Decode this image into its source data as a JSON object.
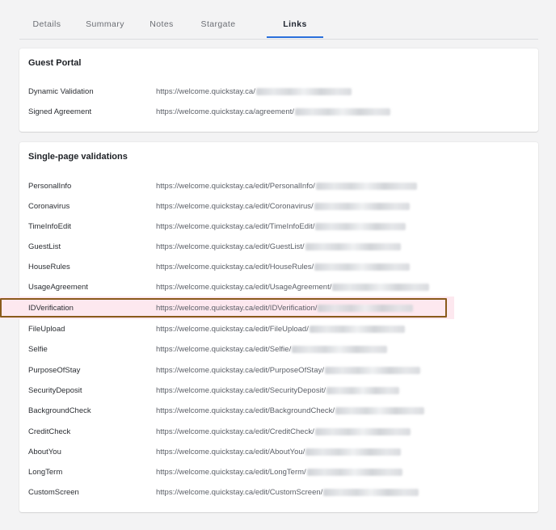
{
  "tabs": [
    {
      "label": "Details"
    },
    {
      "label": "Summary"
    },
    {
      "label": "Notes"
    },
    {
      "label": "Stargate"
    },
    {
      "label": "Links",
      "active": true
    }
  ],
  "guest_portal": {
    "title": "Guest Portal",
    "rows": [
      {
        "label": "Dynamic Validation",
        "url": "https://welcome.quickstay.ca/"
      },
      {
        "label": "Signed Agreement",
        "url": "https://welcome.quickstay.ca/agreement/"
      }
    ]
  },
  "single_page": {
    "title": "Single-page validations",
    "rows": [
      {
        "label": "PersonalInfo",
        "url": "https://welcome.quickstay.ca/edit/PersonalInfo/"
      },
      {
        "label": "Coronavirus",
        "url": "https://welcome.quickstay.ca/edit/Coronavirus/"
      },
      {
        "label": "TimeInfoEdit",
        "url": "https://welcome.quickstay.ca/edit/TimeInfoEdit/"
      },
      {
        "label": "GuestList",
        "url": "https://welcome.quickstay.ca/edit/GuestList/"
      },
      {
        "label": "HouseRules",
        "url": "https://welcome.quickstay.ca/edit/HouseRules/"
      },
      {
        "label": "UsageAgreement",
        "url": "https://welcome.quickstay.ca/edit/UsageAgreement/"
      },
      {
        "label": "IDVerification",
        "url": "https://welcome.quickstay.ca/edit/IDVerification/",
        "highlighted": true
      },
      {
        "label": "FileUpload",
        "url": "https://welcome.quickstay.ca/edit/FileUpload/"
      },
      {
        "label": "Selfie",
        "url": "https://welcome.quickstay.ca/edit/Selfie/"
      },
      {
        "label": "PurposeOfStay",
        "url": "https://welcome.quickstay.ca/edit/PurposeOfStay/"
      },
      {
        "label": "SecurityDeposit",
        "url": "https://welcome.quickstay.ca/edit/SecurityDeposit/"
      },
      {
        "label": "BackgroundCheck",
        "url": "https://welcome.quickstay.ca/edit/BackgroundCheck/"
      },
      {
        "label": "CreditCheck",
        "url": "https://welcome.quickstay.ca/edit/CreditCheck/"
      },
      {
        "label": "AboutYou",
        "url": "https://welcome.quickstay.ca/edit/AboutYou/"
      },
      {
        "label": "LongTerm",
        "url": "https://welcome.quickstay.ca/edit/LongTerm/"
      },
      {
        "label": "CustomScreen",
        "url": "https://welcome.quickstay.ca/edit/CustomScreen/"
      }
    ]
  },
  "colors": {
    "accent": "#2a6fdb",
    "highlight_border": "#8a5a1b",
    "highlight_bg": "#fde8ef"
  }
}
